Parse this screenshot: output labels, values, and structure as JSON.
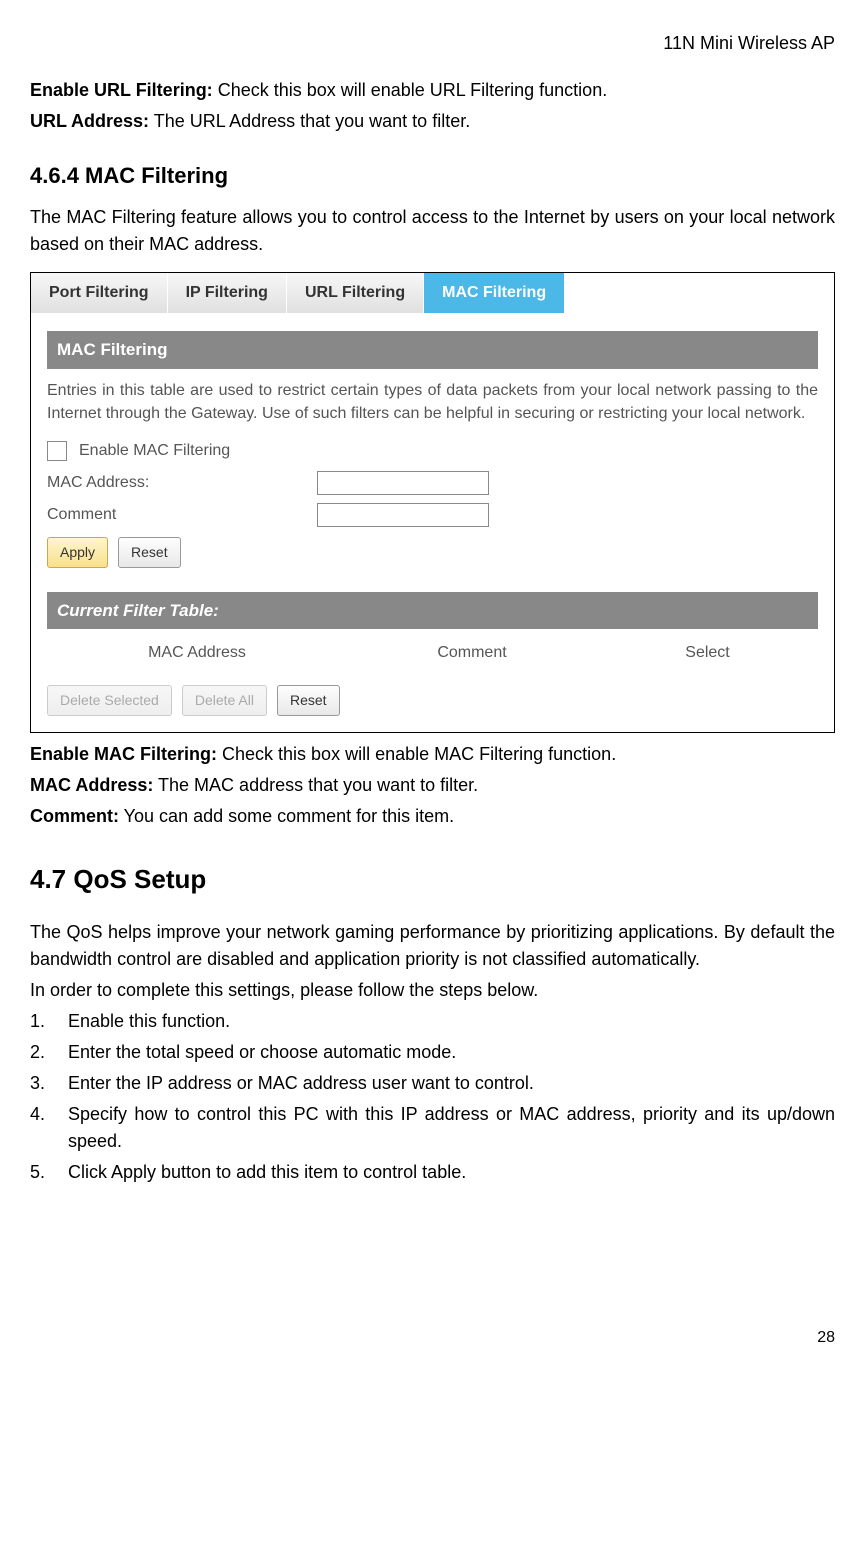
{
  "header": {
    "title": "11N Mini Wireless AP"
  },
  "intro": {
    "url_filtering_label": "Enable URL Filtering:",
    "url_filtering_desc": " Check this box will enable URL Filtering function.",
    "url_address_label": "URL Address:",
    "url_address_desc": " The URL Address that you want to filter."
  },
  "section_464": {
    "heading": "4.6.4 MAC Filtering",
    "para": "The MAC Filtering feature allows you to control access to the Internet by users on your local network based on their MAC address."
  },
  "ui": {
    "tabs": {
      "port": "Port Filtering",
      "ip": "IP Filtering",
      "url": "URL Filtering",
      "mac": "MAC Filtering"
    },
    "panel_title": "MAC Filtering",
    "panel_desc": "Entries in this table are used to restrict certain types of data packets from your local network passing to the Internet through the Gateway. Use of such filters can be helpful in securing or restricting your local network.",
    "enable_label": "Enable MAC Filtering",
    "mac_label": "MAC Address:",
    "comment_label": "Comment",
    "apply": "Apply",
    "reset": "Reset",
    "table_title": "Current Filter Table:",
    "col_mac": "MAC Address",
    "col_comment": "Comment",
    "col_select": "Select",
    "delete_selected": "Delete Selected",
    "delete_all": "Delete All",
    "reset2": "Reset"
  },
  "defs": {
    "enable_mac_label": "Enable MAC Filtering:",
    "enable_mac_desc": " Check this box will enable MAC Filtering function.",
    "mac_addr_label": "MAC Address:",
    "mac_addr_desc": " The MAC address that you want to filter.",
    "comment_label": "Comment:",
    "comment_desc": " You can add some comment for this item."
  },
  "section_47": {
    "heading": "4.7 QoS Setup",
    "para1": "The QoS helps improve your network gaming performance by prioritizing applications. By default the bandwidth control are disabled and application priority is not classified automatically.",
    "para2": "In order to complete this settings, please follow the steps below.",
    "items": [
      "Enable this function.",
      "Enter the total speed or choose automatic mode.",
      "Enter the IP address or MAC address user want to control.",
      "Specify how to control this PC with this IP address or MAC address, priority and its up/down speed.",
      "Click Apply button to add this item to control table."
    ]
  },
  "page_number": "28"
}
